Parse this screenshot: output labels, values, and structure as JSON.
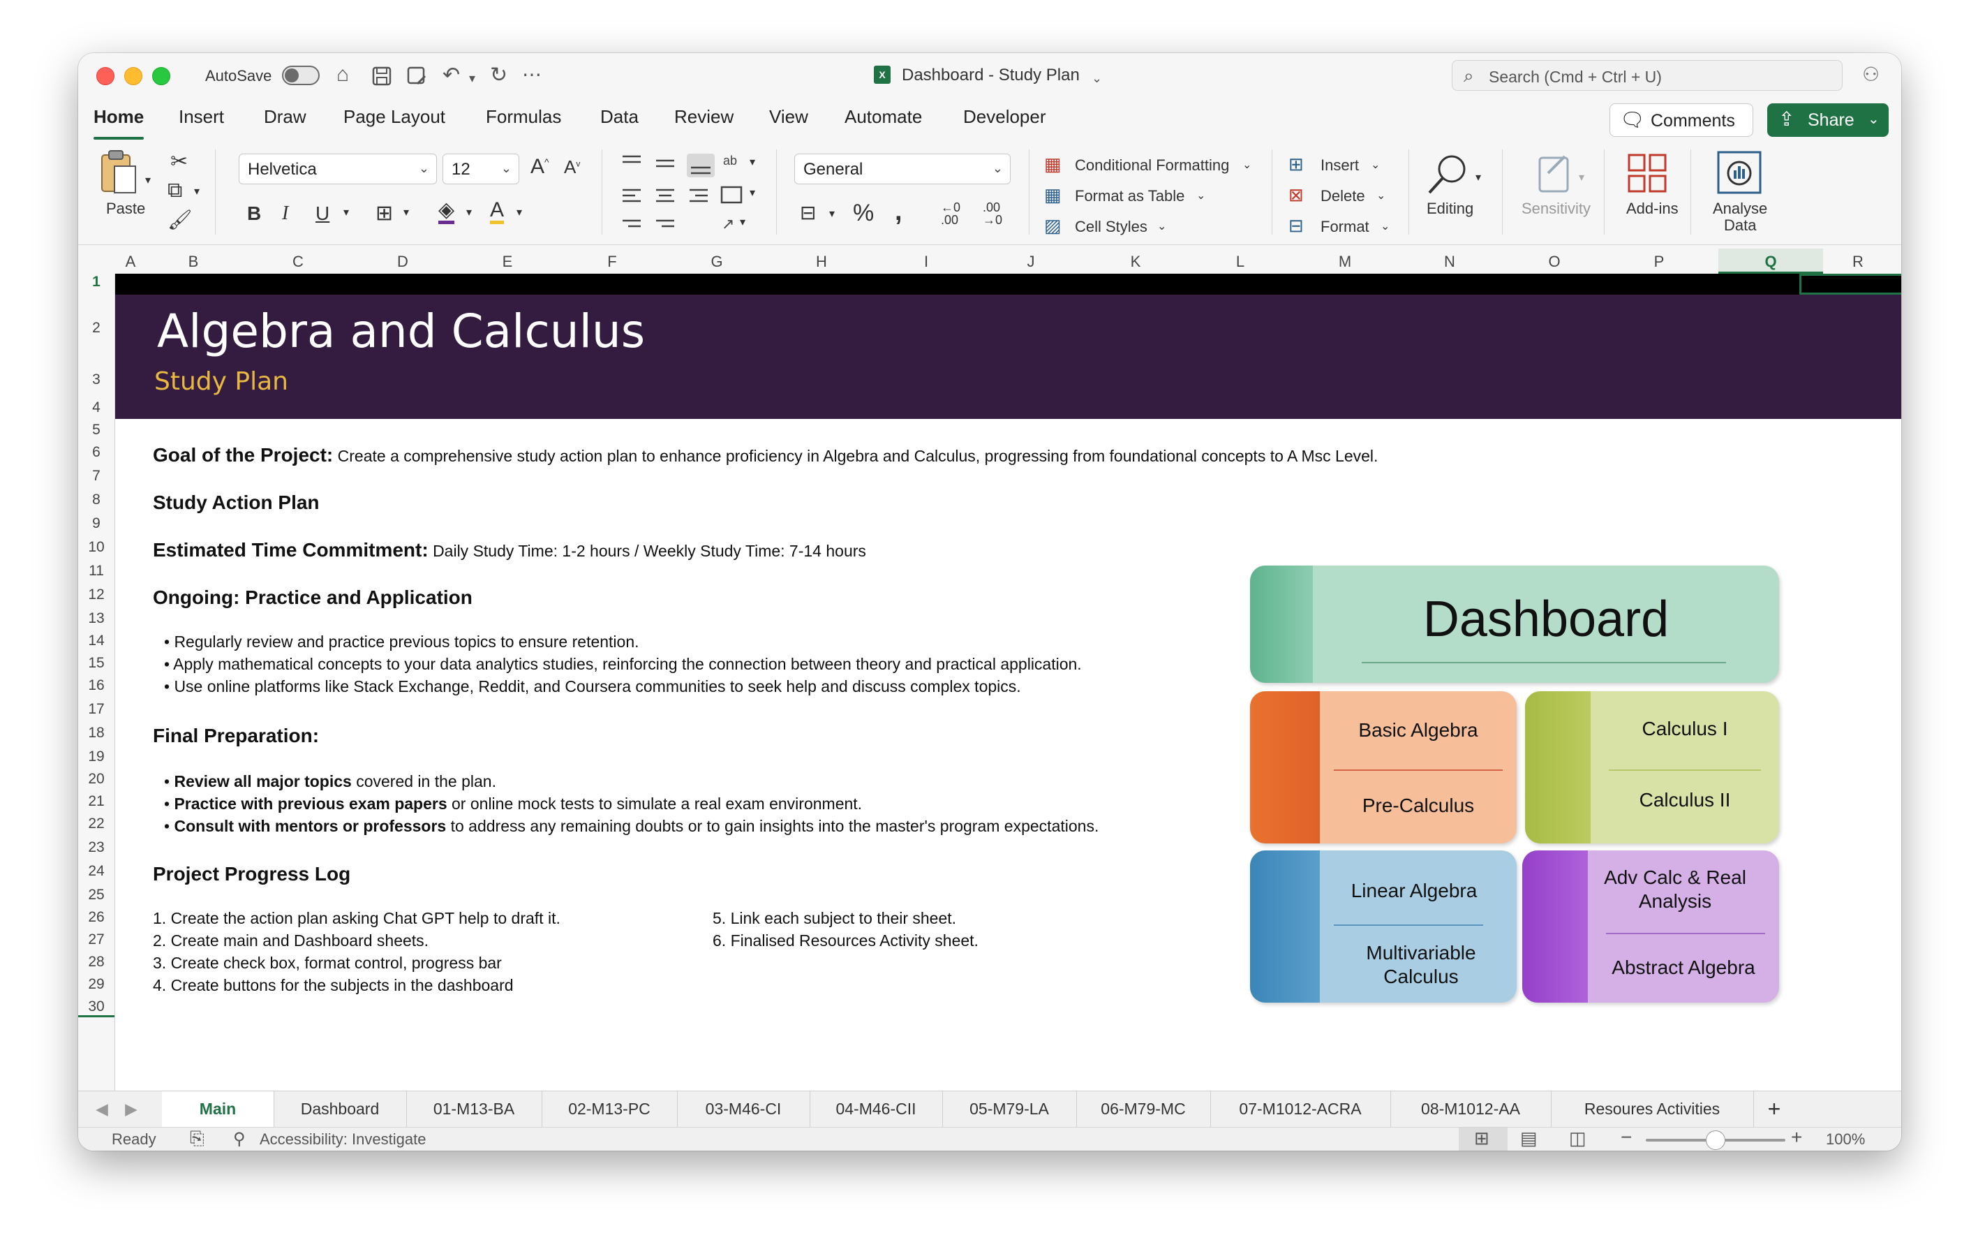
{
  "window": {
    "autosave_label": "AutoSave",
    "doc_title": "Dashboard - Study Plan",
    "search_placeholder": "Search (Cmd + Ctrl + U)"
  },
  "ribbon_tabs": [
    "Home",
    "Insert",
    "Draw",
    "Page Layout",
    "Formulas",
    "Data",
    "Review",
    "View",
    "Automate",
    "Developer"
  ],
  "buttons": {
    "comments": "Comments",
    "share": "Share"
  },
  "ribbon": {
    "paste": "Paste",
    "font_name": "Helvetica",
    "font_size": "12",
    "number_format": "General",
    "conditional_formatting": "Conditional Formatting",
    "format_as_table": "Format as Table",
    "cell_styles": "Cell Styles",
    "insert": "Insert",
    "delete": "Delete",
    "format": "Format",
    "editing": "Editing",
    "sensitivity": "Sensitivity",
    "addins": "Add-ins",
    "analyse": "Analyse",
    "analyse_data": "Data"
  },
  "columns": [
    "A",
    "B",
    "C",
    "D",
    "E",
    "F",
    "G",
    "H",
    "I",
    "J",
    "K",
    "L",
    "M",
    "N",
    "O",
    "P",
    "Q",
    "R"
  ],
  "rows": [
    "1",
    "2",
    "3",
    "4",
    "5",
    "6",
    "7",
    "8",
    "9",
    "10",
    "11",
    "12",
    "13",
    "14",
    "15",
    "16",
    "17",
    "18",
    "19",
    "20",
    "21",
    "22",
    "23",
    "24",
    "25",
    "26",
    "27",
    "28",
    "29",
    "30"
  ],
  "sheet": {
    "title": "Algebra and Calculus",
    "subtitle": "Study Plan",
    "goal_label": "Goal of the Project:",
    "goal_text": "Create a comprehensive study action plan to enhance proficiency in Algebra and Calculus, progressing from foundational concepts to A Msc Level.",
    "action_plan": "Study Action Plan",
    "time_label": "Estimated Time Commitment:",
    "time_text": "Daily Study Time: 1-2 hours / Weekly Study Time: 7-14 hours",
    "ongoing": "Ongoing: Practice and Application",
    "ongoing_items": [
      "• Regularly review and practice previous topics to ensure retention.",
      "• Apply mathematical concepts to your data analytics studies, reinforcing the connection between theory and practical application.",
      "• Use online platforms like Stack Exchange, Reddit, and Coursera communities to seek help and discuss complex topics."
    ],
    "final": "Final Preparation:",
    "final_items": [
      {
        "bullet": "•",
        "bold": "Review all major topics",
        "rest": " covered in the plan."
      },
      {
        "bullet": "•",
        "bold": "Practice with previous exam papers",
        "rest": " or online mock tests to simulate a real exam environment."
      },
      {
        "bullet": "•",
        "bold": "Consult with mentors or professors",
        "rest": " to address any remaining doubts or to gain insights into the master's program expectations."
      }
    ],
    "progress_log": "Project Progress Log",
    "log_left": [
      "1. Create the action plan asking Chat GPT help to draft it.",
      "2. Create main and Dashboard sheets.",
      "3. Create check box, format control, progress bar",
      "4. Create buttons for the subjects in the dashboard"
    ],
    "log_right": [
      "5. Link each subject to their sheet.",
      "6. Finalised Resources Activity sheet."
    ]
  },
  "dashboard": {
    "title": "Dashboard",
    "cards": [
      {
        "top": "Basic Algebra",
        "bottom": "Pre-Calculus"
      },
      {
        "top": "Calculus I",
        "bottom": "Calculus II"
      },
      {
        "top": "Linear Algebra",
        "bottom": "Multivariable Calculus"
      },
      {
        "top": "Adv Calc & Real Analysis",
        "bottom": "Abstract Algebra"
      }
    ]
  },
  "sheet_tabs": [
    "Main",
    "Dashboard",
    "01-M13-BA",
    "02-M13-PC",
    "03-M46-CI",
    "04-M46-CII",
    "05-M79-LA",
    "06-M79-MC",
    "07-M1012-ACRA",
    "08-M1012-AA",
    "Resoures Activities"
  ],
  "status": {
    "ready": "Ready",
    "accessibility": "Accessibility: Investigate",
    "zoom": "100%"
  }
}
